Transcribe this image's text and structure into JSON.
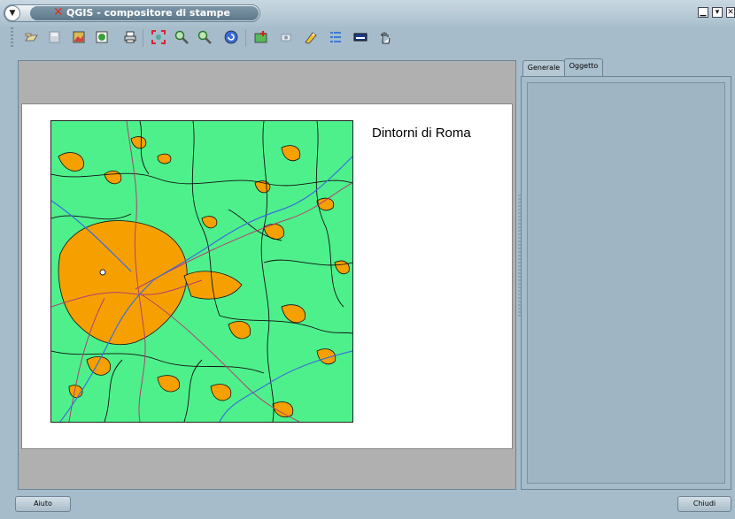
{
  "window": {
    "title": "QGIS - compositore di stampe",
    "app_icon": "qgis-x-icon",
    "controls": [
      "minimize-icon",
      "maximize-icon",
      "close-icon"
    ]
  },
  "toolbar": {
    "items": [
      "open-template-icon",
      "save-template-icon",
      "export-image-icon",
      "export-svg-icon",
      "print-icon",
      "zoom-full-icon",
      "zoom-in-icon",
      "zoom-out-icon",
      "refresh-icon",
      "add-map-icon",
      "add-image-icon",
      "add-label-icon",
      "add-legend-icon",
      "add-scalebar-icon",
      "select-move-icon"
    ]
  },
  "composition": {
    "label_text": "Dintorni di Roma",
    "map_colors": {
      "land": "#4ef08c",
      "urban": "#f5a000",
      "boundary": "#111111",
      "river": "#3a6fd8",
      "road": "#b04070"
    }
  },
  "panel": {
    "tabs": [
      "Generale",
      "Oggetto"
    ],
    "active_tab": "Oggetto"
  },
  "buttons": {
    "help": "Aiuto",
    "close": "Chiudi"
  }
}
